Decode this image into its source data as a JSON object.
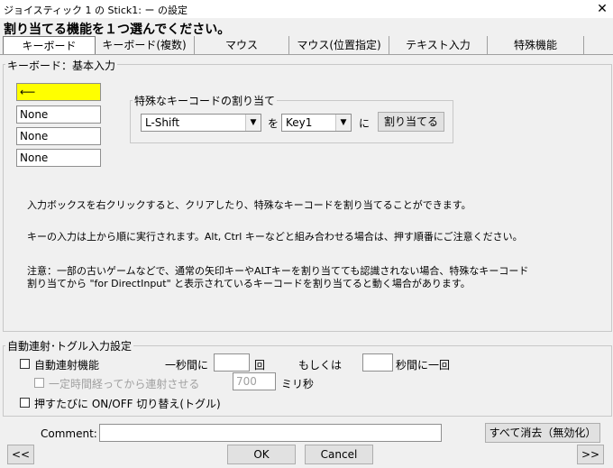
{
  "window": {
    "title": "ジョイスティック 1 の Stick1: ー の設定",
    "close_glyph": "✕"
  },
  "heading": "割り当てる機能を１つ選んでください。",
  "tabs": [
    {
      "label": "キーボード"
    },
    {
      "label": "キーボード(複数)"
    },
    {
      "label": "マウス"
    },
    {
      "label": "マウス(位置指定)"
    },
    {
      "label": "テキスト入力"
    },
    {
      "label": "特殊機能"
    }
  ],
  "keyboard": {
    "group_label": "キーボード：基本入力",
    "inputs": [
      "⟵",
      "None",
      "None",
      "None"
    ],
    "special": {
      "label": "特殊なキーコードの割り当て",
      "key_select": "L-Shift",
      "wo": "を",
      "target_select": "Key1",
      "ni": "に",
      "assign_button": "割り当てる"
    },
    "info": [
      "入力ボックスを右クリックすると、クリアしたり、特殊なキーコードを割り当てることができます。",
      "キーの入力は上から順に実行されます。Alt, Ctrl キーなどと組み合わせる場合は、押す順番にご注意ください。",
      "注意：一部の古いゲームなどで、通常の矢印キーやALTキーを割り当てても認識されない場合、特殊なキーコード",
      "割り当てから \"for DirectInput\" と表示されているキーコードを割り当てると動く場合があります。"
    ]
  },
  "autofire": {
    "group_label": "自動連射･トグル入力設定",
    "rapid_label": "自動連射機能",
    "per_second": "一秒間に",
    "times": "回",
    "or": "もしくは",
    "seconds_per": "秒間に一回",
    "delay_label": "一定時間経ってから連射させる",
    "delay_value": "700",
    "ms": "ミリ秒",
    "toggle_label": "押すたびに ON/OFF 切り替え(トグル)"
  },
  "footer": {
    "comment_label": "Comment:",
    "clear_all": "すべて消去（無効化）",
    "prev": "<<",
    "ok": "OK",
    "cancel": "Cancel",
    "next": ">>"
  }
}
